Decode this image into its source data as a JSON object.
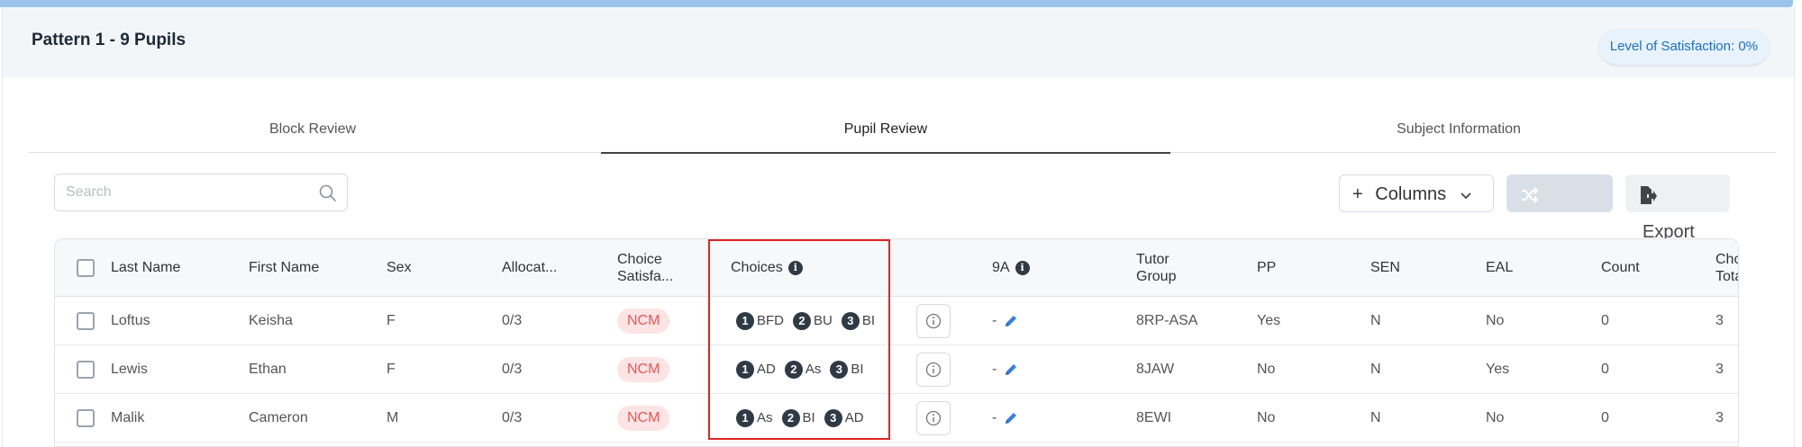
{
  "card": {
    "title": "Pattern 1 - 9 Pupils",
    "satisfaction": "Level of Satisfaction: 0%"
  },
  "tabs": [
    {
      "label": "Block Review",
      "active": false
    },
    {
      "label": "Pupil Review",
      "active": true
    },
    {
      "label": "Subject Information",
      "active": false
    }
  ],
  "toolbar": {
    "search_placeholder": "Search",
    "columns_label": "Columns",
    "shuffle_label": "Shuffle",
    "export_label": "Export"
  },
  "table": {
    "headers": {
      "last_name": "Last Name",
      "first_name": "First Name",
      "sex": "Sex",
      "allocated": "Allocat...",
      "choice_satisfaction_1": "Choice",
      "choice_satisfaction_2": "Satisfa...",
      "choices": "Choices",
      "block_9a": "9A",
      "tutor_group_1": "Tutor",
      "tutor_group_2": "Group",
      "pp": "PP",
      "sen": "SEN",
      "eal": "EAL",
      "count": "Count",
      "choice_total_1": "Choi",
      "choice_total_2": "Tota"
    },
    "rows": [
      {
        "last_name": "Loftus",
        "first_name": "Keisha",
        "sex": "F",
        "allocated": "0/3",
        "satisfaction": "NCM",
        "choices": [
          {
            "n": "1",
            "code": "BFD"
          },
          {
            "n": "2",
            "code": "BU"
          },
          {
            "n": "3",
            "code": "BI"
          }
        ],
        "block_9a": "-",
        "tutor_group": "8RP-ASA",
        "pp": "Yes",
        "sen": "N",
        "eal": "No",
        "count": "0",
        "choice_total": "3"
      },
      {
        "last_name": "Lewis",
        "first_name": "Ethan",
        "sex": "F",
        "allocated": "0/3",
        "satisfaction": "NCM",
        "choices": [
          {
            "n": "1",
            "code": "AD"
          },
          {
            "n": "2",
            "code": "As"
          },
          {
            "n": "3",
            "code": "BI"
          }
        ],
        "block_9a": "-",
        "tutor_group": "8JAW",
        "pp": "No",
        "sen": "N",
        "eal": "Yes",
        "count": "0",
        "choice_total": "3"
      },
      {
        "last_name": "Malik",
        "first_name": "Cameron",
        "sex": "M",
        "allocated": "0/3",
        "satisfaction": "NCM",
        "choices": [
          {
            "n": "1",
            "code": "As"
          },
          {
            "n": "2",
            "code": "BI"
          },
          {
            "n": "3",
            "code": "AD"
          }
        ],
        "block_9a": "-",
        "tutor_group": "8EWI",
        "pp": "No",
        "sen": "N",
        "eal": "No",
        "count": "0",
        "choice_total": "3"
      }
    ]
  },
  "colors": {
    "accent": "#1d6fc4",
    "badge_bg": "#fde4e4",
    "badge_text": "#e05a5a",
    "highlight": "#e0261f"
  }
}
